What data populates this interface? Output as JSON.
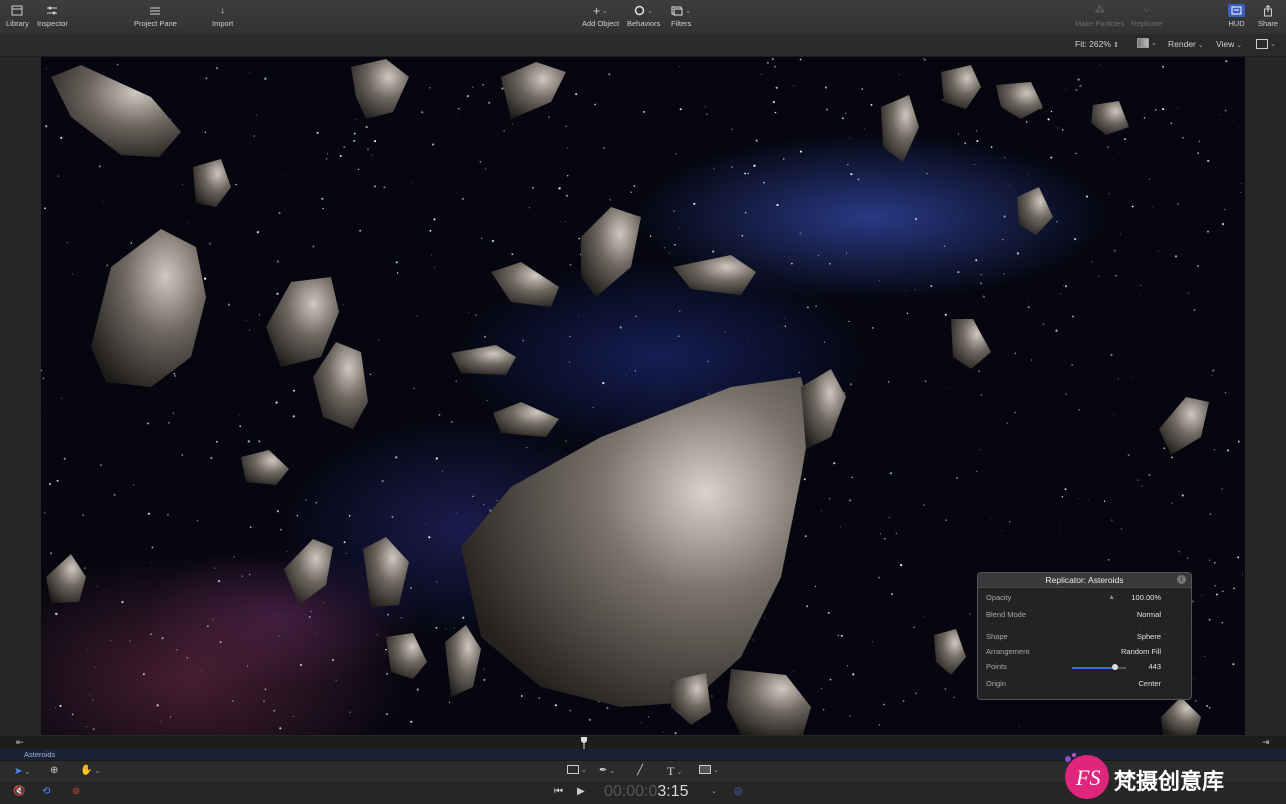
{
  "toolbar": {
    "library": "Library",
    "inspector": "Inspector",
    "project_pane": "Project Pane",
    "import": "Import",
    "add_object": "Add Object",
    "behaviors": "Behaviors",
    "filters": "Filters",
    "make_particles": "Make Particles",
    "replicate": "Replicate",
    "hud": "HUD",
    "share": "Share"
  },
  "viewer_bar": {
    "fit": "Fit: 262%",
    "render": "Render",
    "view": "View"
  },
  "hud": {
    "title": "Replicator: Asteroids",
    "opacity_label": "Opacity",
    "opacity_value": "100.00%",
    "blend_label": "Blend Mode",
    "blend_value": "Normal",
    "shape_label": "Shape",
    "shape_value": "Sphere",
    "arrangement_label": "Arrangement",
    "arrangement_value": "Random Fill",
    "points_label": "Points",
    "points_value": "443",
    "points_fraction": 0.8,
    "origin_label": "Origin",
    "origin_value": "Center"
  },
  "timeline": {
    "track_label": "Asteroids",
    "timecode_dim": "00:00:0",
    "timecode_main": "3:15"
  },
  "watermark": "梵摄创意库",
  "colors": {
    "accent": "#3b6fd6",
    "hud_active": "#3a5fbf"
  }
}
